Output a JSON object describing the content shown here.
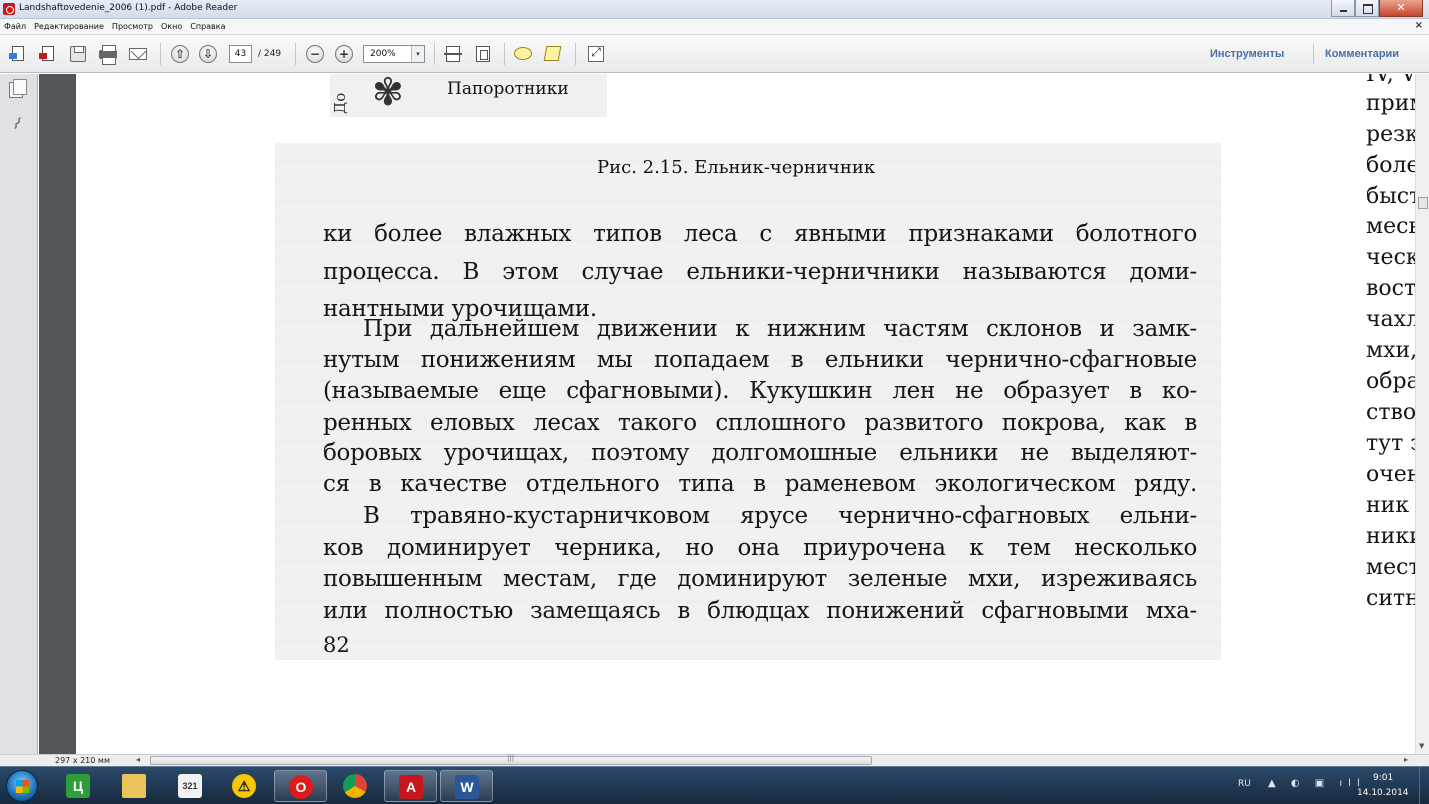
{
  "window": {
    "title": "Landshaftovedenie_2006 (1).pdf - Adobe Reader"
  },
  "menu": {
    "items": [
      "Файл",
      "Редактирование",
      "Просмотр",
      "Окно",
      "Справка"
    ],
    "close_glyph": "×"
  },
  "toolbar": {
    "current_page": "43",
    "total_pages": "/ 249",
    "zoom": "200%",
    "tools_label": "Инструменты",
    "comments_label": "Комментарии",
    "page_up_glyph": "⇧",
    "page_down_glyph": "⇩",
    "zoom_out_glyph": "−",
    "zoom_in_glyph": "+",
    "zoom_arrow": "▾"
  },
  "document": {
    "fig_header_vertical": "До",
    "fig_header_label": "Папоротники",
    "caption": "Рис. 2.15. Ельник-черничник",
    "lines": [
      "ки более влажных типов леса с явными признаками болотного",
      "процесса. В этом случае ельники-черничники называются доми-",
      "нантными урочищами.",
      "При дальнейшем движении к нижним частям склонов и замк-",
      "нутым понижениям мы попадаем в ельники чернично-сфагновые",
      "(называемые еще сфагновыми). Кукушкин лен не образует в ко-",
      "ренных еловых лесах такого сплошного развитого покрова, как в",
      "боровых урочищах, поэтому долгомошные ельники не выделяют-",
      "ся в качестве отдельного типа в раменевом экологическом ряду.",
      "В травяно-кустарничковом ярусе чернично-сфагновых ельни-",
      "ков доминирует черника, но она приурочена к тем несколько",
      "повышенным местам, где доминируют зеленые мхи, изреживаясь",
      "или полностью замещаясь в блюдцах понижений сфагновыми мха-"
    ],
    "page_number": "82",
    "right_column": [
      "IV, V",
      "примес",
      "резко в",
      "более в",
      "быстре",
      "месь с",
      "ческом",
      "востой",
      "чахлым",
      "мхи, ч",
      "образу",
      "стволо",
      "тут зел",
      "очень",
      "ник лу",
      "ники л",
      "местах",
      "ситник"
    ]
  },
  "status": {
    "page_size": "297 x 210 мм"
  },
  "taskbar": {
    "apps": [
      {
        "icon": "green-app-icon",
        "glyph": "Ц"
      },
      {
        "icon": "folder-icon",
        "glyph": ""
      },
      {
        "icon": "calendar-icon",
        "glyph": "321"
      },
      {
        "icon": "warning-icon",
        "glyph": "⚠"
      },
      {
        "icon": "opera-icon",
        "glyph": "O"
      },
      {
        "icon": "chrome-icon",
        "glyph": ""
      },
      {
        "icon": "adobe-reader-icon",
        "glyph": "A"
      },
      {
        "icon": "word-icon",
        "glyph": "W"
      }
    ],
    "language": "RU",
    "tray_glyphs": "▲ ◐ ▣ ıll",
    "time": "9:01",
    "date": "14.10.2014"
  },
  "colors": {
    "accent_link": "#4a6ea9",
    "viewport_bg": "#525659",
    "taskbar_bg": "#1d3550"
  }
}
